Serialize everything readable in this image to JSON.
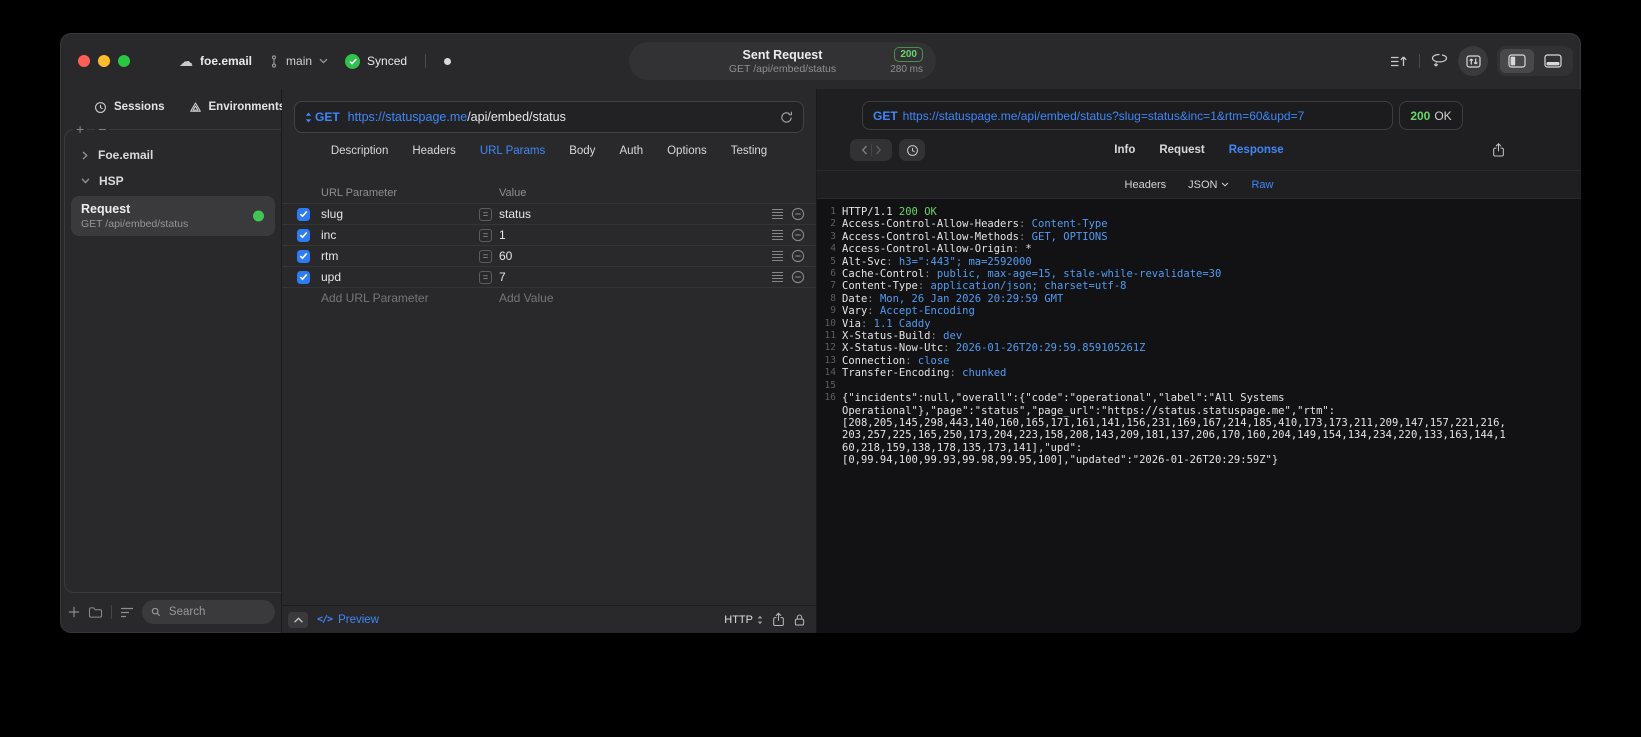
{
  "titlebar": {
    "project": "foe.email",
    "branch": "main",
    "sync_label": "Synced",
    "request_title": "Sent Request",
    "request_subtitle": "GET /api/embed/status",
    "status_code": "200",
    "duration": "280 ms"
  },
  "sidebar": {
    "tabs": [
      "Sessions",
      "Environments"
    ],
    "tree": [
      {
        "label": "Foe.email"
      },
      {
        "label": "HSP"
      }
    ],
    "request_item": {
      "title": "Request",
      "subtitle": "GET /api/embed/status"
    },
    "search_placeholder": "Search"
  },
  "request_editor": {
    "method": "GET",
    "url_host": "https://statuspage.me",
    "url_path": "/api/embed/status",
    "tabs": [
      "Description",
      "Headers",
      "URL Params",
      "Body",
      "Auth",
      "Options",
      "Testing"
    ],
    "active_tab": "URL Params",
    "params": {
      "col_name": "URL Parameter",
      "col_value": "Value",
      "rows": [
        {
          "name": "slug",
          "value": "status",
          "enabled": true
        },
        {
          "name": "inc",
          "value": "1",
          "enabled": true
        },
        {
          "name": "rtm",
          "value": "60",
          "enabled": true
        },
        {
          "name": "upd",
          "value": "7",
          "enabled": true
        }
      ],
      "add_name": "Add URL Parameter",
      "add_value": "Add Value"
    },
    "footer": {
      "preview": "Preview",
      "code_glyph": "</>",
      "protocol": "HTTP"
    }
  },
  "response_viewer": {
    "method": "GET",
    "request_line": "https://statuspage.me/api/embed/status?slug=status&inc=1&rtm=60&upd=7",
    "status_code": "200",
    "status_text": "OK",
    "tabs": [
      "Info",
      "Request",
      "Response"
    ],
    "active_tab": "Response",
    "subtabs": [
      "Headers",
      "JSON",
      "Raw"
    ],
    "active_subtab": "Raw",
    "raw_lines": [
      {
        "num": "1",
        "segments": [
          {
            "t": "HTTP/1.1 ",
            "c": "w"
          },
          {
            "t": "200 OK",
            "c": "g"
          }
        ]
      },
      {
        "num": "2",
        "segments": [
          {
            "t": "Access-Control-Allow-Headers",
            "c": "w"
          },
          {
            "t": ": ",
            "c": "d"
          },
          {
            "t": "Content-Type",
            "c": "b"
          }
        ]
      },
      {
        "num": "3",
        "segments": [
          {
            "t": "Access-Control-Allow-Methods",
            "c": "w"
          },
          {
            "t": ": ",
            "c": "d"
          },
          {
            "t": "GET, OPTIONS",
            "c": "b"
          }
        ]
      },
      {
        "num": "4",
        "segments": [
          {
            "t": "Access-Control-Allow-Origin",
            "c": "w"
          },
          {
            "t": ": ",
            "c": "d"
          },
          {
            "t": "*",
            "c": "w"
          }
        ]
      },
      {
        "num": "5",
        "segments": [
          {
            "t": "Alt-Svc",
            "c": "w"
          },
          {
            "t": ": ",
            "c": "d"
          },
          {
            "t": "h3=\":443\"; ma=2592000",
            "c": "b"
          }
        ]
      },
      {
        "num": "6",
        "segments": [
          {
            "t": "Cache-Control",
            "c": "w"
          },
          {
            "t": ": ",
            "c": "d"
          },
          {
            "t": "public, max-age=15, stale-while-revalidate=30",
            "c": "b"
          }
        ]
      },
      {
        "num": "7",
        "segments": [
          {
            "t": "Content-Type",
            "c": "w"
          },
          {
            "t": ": ",
            "c": "d"
          },
          {
            "t": "application/json; charset=utf-8",
            "c": "b"
          }
        ]
      },
      {
        "num": "8",
        "segments": [
          {
            "t": "Date",
            "c": "w"
          },
          {
            "t": ": ",
            "c": "d"
          },
          {
            "t": "Mon, 26 Jan 2026 20:29:59 GMT",
            "c": "b"
          }
        ]
      },
      {
        "num": "9",
        "segments": [
          {
            "t": "Vary",
            "c": "w"
          },
          {
            "t": ": ",
            "c": "d"
          },
          {
            "t": "Accept-Encoding",
            "c": "b"
          }
        ]
      },
      {
        "num": "10",
        "segments": [
          {
            "t": "Via",
            "c": "w"
          },
          {
            "t": ": ",
            "c": "d"
          },
          {
            "t": "1.1 Caddy",
            "c": "b"
          }
        ]
      },
      {
        "num": "11",
        "segments": [
          {
            "t": "X-Status-Build",
            "c": "w"
          },
          {
            "t": ": ",
            "c": "d"
          },
          {
            "t": "dev",
            "c": "b"
          }
        ]
      },
      {
        "num": "12",
        "segments": [
          {
            "t": "X-Status-Now-Utc",
            "c": "w"
          },
          {
            "t": ": ",
            "c": "d"
          },
          {
            "t": "2026-01-26T20:29:59.859105261Z",
            "c": "b"
          }
        ]
      },
      {
        "num": "13",
        "segments": [
          {
            "t": "Connection",
            "c": "w"
          },
          {
            "t": ": ",
            "c": "d"
          },
          {
            "t": "close",
            "c": "b"
          }
        ]
      },
      {
        "num": "14",
        "segments": [
          {
            "t": "Transfer-Encoding",
            "c": "w"
          },
          {
            "t": ": ",
            "c": "d"
          },
          {
            "t": "chunked",
            "c": "b"
          }
        ]
      },
      {
        "num": "15",
        "segments": []
      },
      {
        "num": "16",
        "segments": [
          {
            "t": "{\"incidents\":null,\"overall\":{\"code\":\"operational\",\"label\":\"All Systems",
            "c": "w"
          }
        ]
      },
      {
        "num": "",
        "segments": [
          {
            "t": "Operational\"},\"page\":\"status\",\"page_url\":\"https://status.statuspage.me\",\"rtm\":",
            "c": "w"
          }
        ]
      },
      {
        "num": "",
        "segments": [
          {
            "t": "[208,205,145,298,443,140,160,165,171,161,141,156,231,169,167,214,185,410,173,173,211,209,147,157,221,216,",
            "c": "w"
          }
        ]
      },
      {
        "num": "",
        "segments": [
          {
            "t": "203,257,225,165,250,173,204,223,158,208,143,209,181,137,206,170,160,204,149,154,134,234,220,133,163,144,1",
            "c": "w"
          }
        ]
      },
      {
        "num": "",
        "segments": [
          {
            "t": "60,218,159,138,178,135,173,141],\"upd\":",
            "c": "w"
          }
        ]
      },
      {
        "num": "",
        "segments": [
          {
            "t": "[0,99.94,100,99.93,99.98,99.95,100],\"updated\":\"2026-01-26T20:29:59Z\"}",
            "c": "w"
          }
        ]
      }
    ]
  }
}
